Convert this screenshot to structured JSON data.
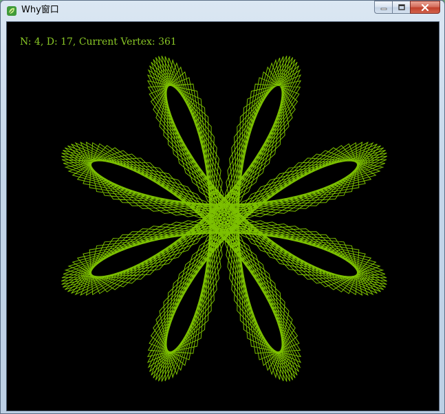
{
  "window": {
    "title": "Why窗口",
    "icon": "leaf-icon",
    "controls": {
      "minimize_icon": "minimize-icon",
      "maximize_icon": "maximize-icon",
      "close_icon": "close-icon"
    }
  },
  "canvas": {
    "status": "N: 4, D: 17, Current Vertex: 361",
    "n": 4,
    "d": 17,
    "current_vertex": 361,
    "background": "#000000",
    "line_color": "#7cc000"
  }
}
